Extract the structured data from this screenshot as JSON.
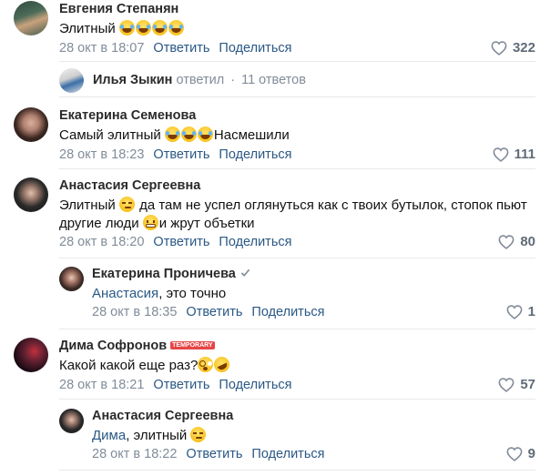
{
  "comments": [
    {
      "name": "Евгения Степанян",
      "text_before": "Элитный ",
      "date": "28 окт в 18:07",
      "reply": "Ответить",
      "share": "Поделиться",
      "likes": "322",
      "avatar_colors": [
        "#3a5a4a",
        "#c9a87a"
      ]
    },
    {
      "thread_name": "Илья Зыкин",
      "thread_action": "ответил",
      "thread_dot": "·",
      "thread_count": "11 ответов"
    },
    {
      "name": "Екатерина Семенова",
      "text_before": "Самый элитный ",
      "text_after": "Насмешили",
      "date": "28 окт в 18:23",
      "reply": "Ответить",
      "share": "Поделиться",
      "likes": "111"
    },
    {
      "name": "Анастасия Сергеевна",
      "text_line1_a": "Элитный ",
      "text_line1_b": " да там не успел оглянуться как с твоих бутылок, стопок пьют",
      "text_line2_a": "другие люди ",
      "text_line2_b": "и жрут объетки",
      "date": "28 окт в 18:20",
      "reply": "Ответить",
      "share": "Поделиться",
      "likes": "80"
    },
    {
      "name": "Екатерина Проничева",
      "mention": "Анастасия",
      "text": ", это точно",
      "date": "28 окт в 18:35",
      "reply": "Ответить",
      "share": "Поделиться",
      "likes": "1"
    },
    {
      "name": "Дима Софронов",
      "badge": "TEMPORARY",
      "text": "Какой какой еще раз?",
      "date": "28 окт в 18:21",
      "reply": "Ответить",
      "share": "Поделиться",
      "likes": "57"
    },
    {
      "name": "Анастасия Сергеевна",
      "mention": "Дима",
      "text": ", элитный ",
      "date": "28 окт в 18:22",
      "reply": "Ответить",
      "share": "Поделиться",
      "likes": "9"
    }
  ]
}
